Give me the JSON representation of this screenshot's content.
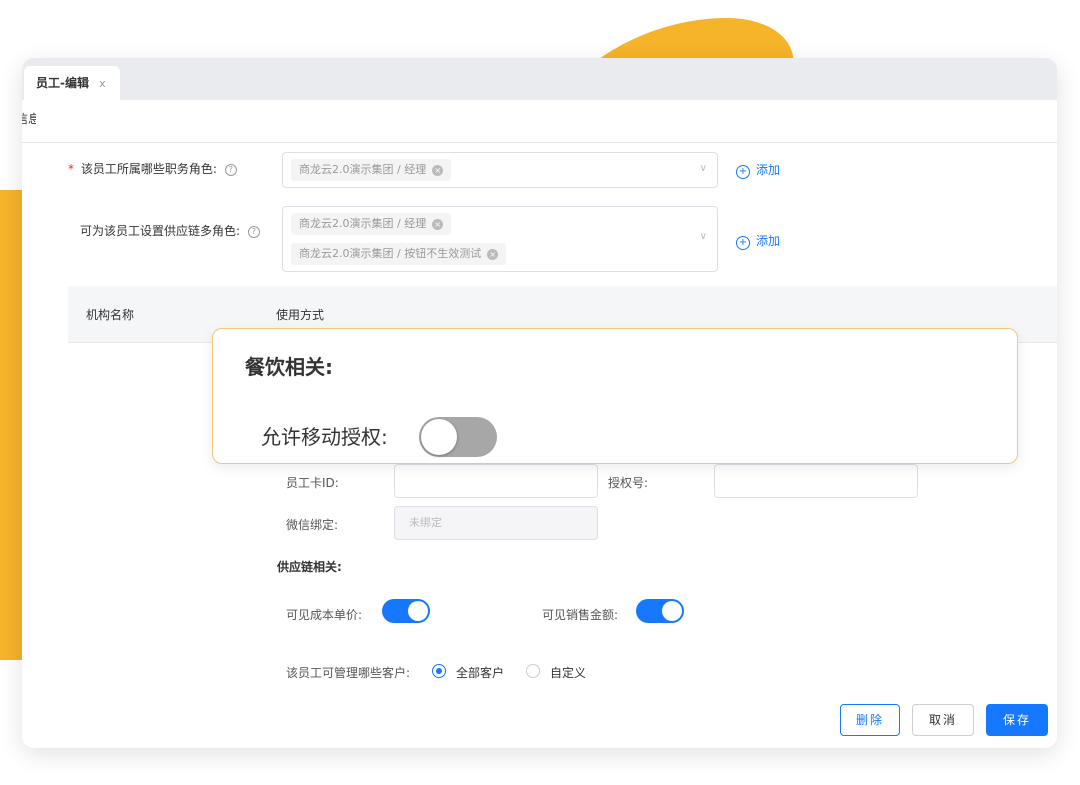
{
  "tab": {
    "title": "员工-编辑",
    "close": "x"
  },
  "section_label_cut": "信息",
  "form": {
    "position_roles": {
      "label": "该员工所属哪些职务角色:",
      "required_mark": "*",
      "chips": [
        "商龙云2.0演示集团 / 经理"
      ],
      "add": "添加"
    },
    "supply_roles": {
      "label": "可为该员工设置供应链多角色:",
      "chips": [
        "商龙云2.0演示集团 / 经理",
        "商龙云2.0演示集团 / 按钮不生效测试"
      ],
      "add": "添加"
    }
  },
  "table": {
    "col1": "机构名称",
    "col2": "使用方式"
  },
  "popup": {
    "title": "餐饮相关:",
    "toggle_label": "允许移动授权:",
    "toggle_on": false
  },
  "fields": {
    "card_id_label": "员工卡ID:",
    "auth_no_label": "授权号:",
    "wechat_label": "微信绑定:",
    "wechat_value": "未绑定"
  },
  "supply": {
    "title": "供应链相关:",
    "cost_label": "可见成本单价:",
    "cost_on": true,
    "sales_label": "可见销售金额:",
    "sales_on": true,
    "customers_label": "该员工可管理哪些客户:",
    "option_all": "全部客户",
    "option_custom": "自定义",
    "selected": "全部客户"
  },
  "buttons": {
    "delete": "删除",
    "cancel": "取消",
    "save": "保存"
  },
  "colors": {
    "accent": "#1677ff",
    "brand_yellow": "#f5b42a"
  }
}
